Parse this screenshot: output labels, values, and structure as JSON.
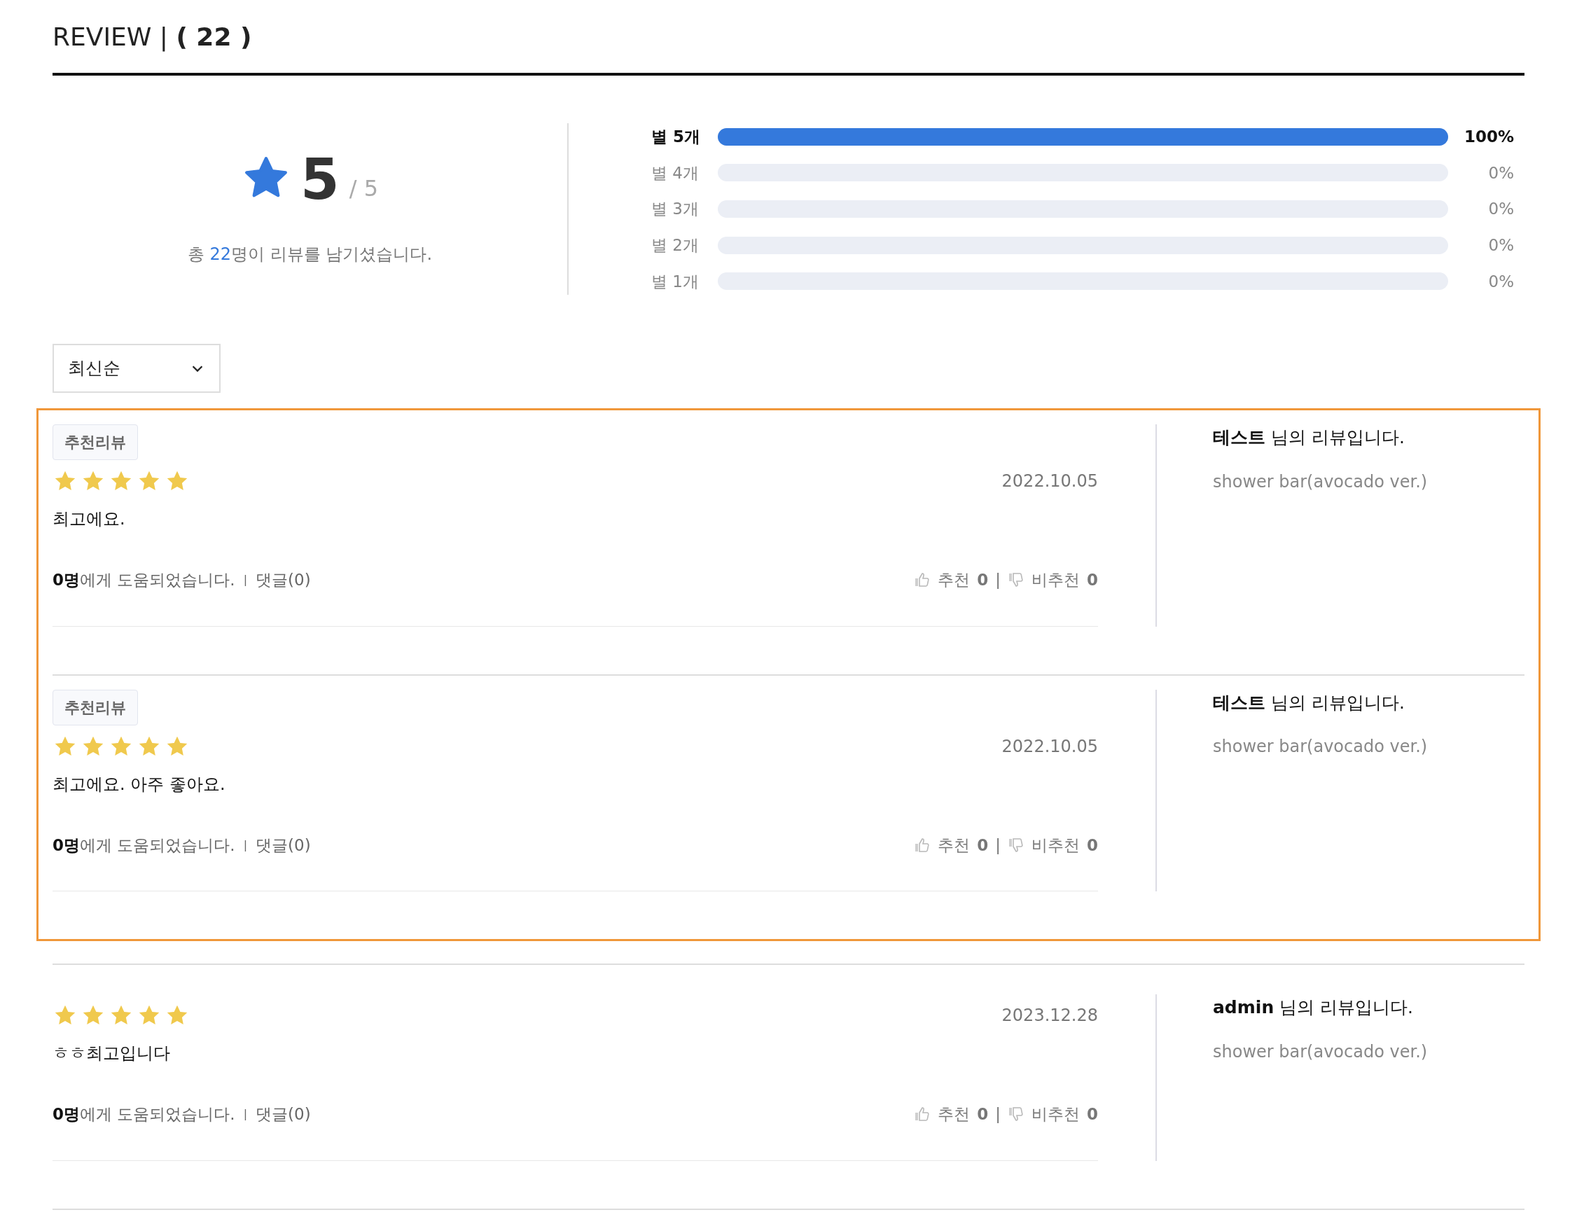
{
  "title": "REVIEW | **( 22 )**",
  "summary": {
    "score": "5",
    "out_of": "/ 5",
    "total_prefix": "총 ",
    "total_count": "22",
    "total_suffix": "명이 리뷰를 남기셨습니다."
  },
  "distribution": [
    {
      "label": "별 5개",
      "level": 1,
      "percent": "100%",
      "highlighted": true
    },
    {
      "label": "별 4개",
      "level": 0,
      "percent": "0%",
      "highlighted": false
    },
    {
      "label": "별 3개",
      "level": 0,
      "percent": "0%",
      "highlighted": false
    },
    {
      "label": "별 2개",
      "level": 0,
      "percent": "0%",
      "highlighted": false
    },
    {
      "label": "별 1개",
      "level": 0,
      "percent": "0%",
      "highlighted": false
    }
  ],
  "sort": {
    "value": "최신순"
  },
  "recommended_reviews": [
    {
      "badge": "추천리뷰",
      "stars": 5,
      "date": "2022.10.05",
      "text": "최고에요.",
      "helpful": "**0명**에게 도움되었습니다.",
      "divider": "|",
      "comments": "댓글(0)",
      "like_label": "추천",
      "like_count": "0",
      "vote_divider": "|",
      "dislike_label": "비추천",
      "dislike_count": "0",
      "author": "테스트",
      "author_suffix": " 님의 리뷰입니다.",
      "product": "shower bar(avocado ver.)"
    },
    {
      "badge": "추천리뷰",
      "stars": 5,
      "date": "2022.10.05",
      "text": "최고에요. 아주 좋아요.",
      "helpful": "**0명**에게 도움되었습니다.",
      "divider": "|",
      "comments": "댓글(0)",
      "like_label": "추천",
      "like_count": "0",
      "vote_divider": "|",
      "dislike_label": "비추천",
      "dislike_count": "0",
      "author": "테스트",
      "author_suffix": " 님의 리뷰입니다.",
      "product": "shower bar(avocado ver.)"
    }
  ],
  "reviews": [
    {
      "stars": 5,
      "date": "2023.12.28",
      "text": "ㅎㅎ최고입니다",
      "helpful": "**0명**에게 도움되었습니다.",
      "divider": "|",
      "comments": "댓글(0)",
      "like_label": "추천",
      "like_count": "0",
      "vote_divider": "|",
      "dislike_label": "비추천",
      "dislike_count": "0",
      "author": "admin",
      "author_suffix": " 님의 리뷰입니다.",
      "product": "shower bar(avocado ver.)"
    }
  ]
}
